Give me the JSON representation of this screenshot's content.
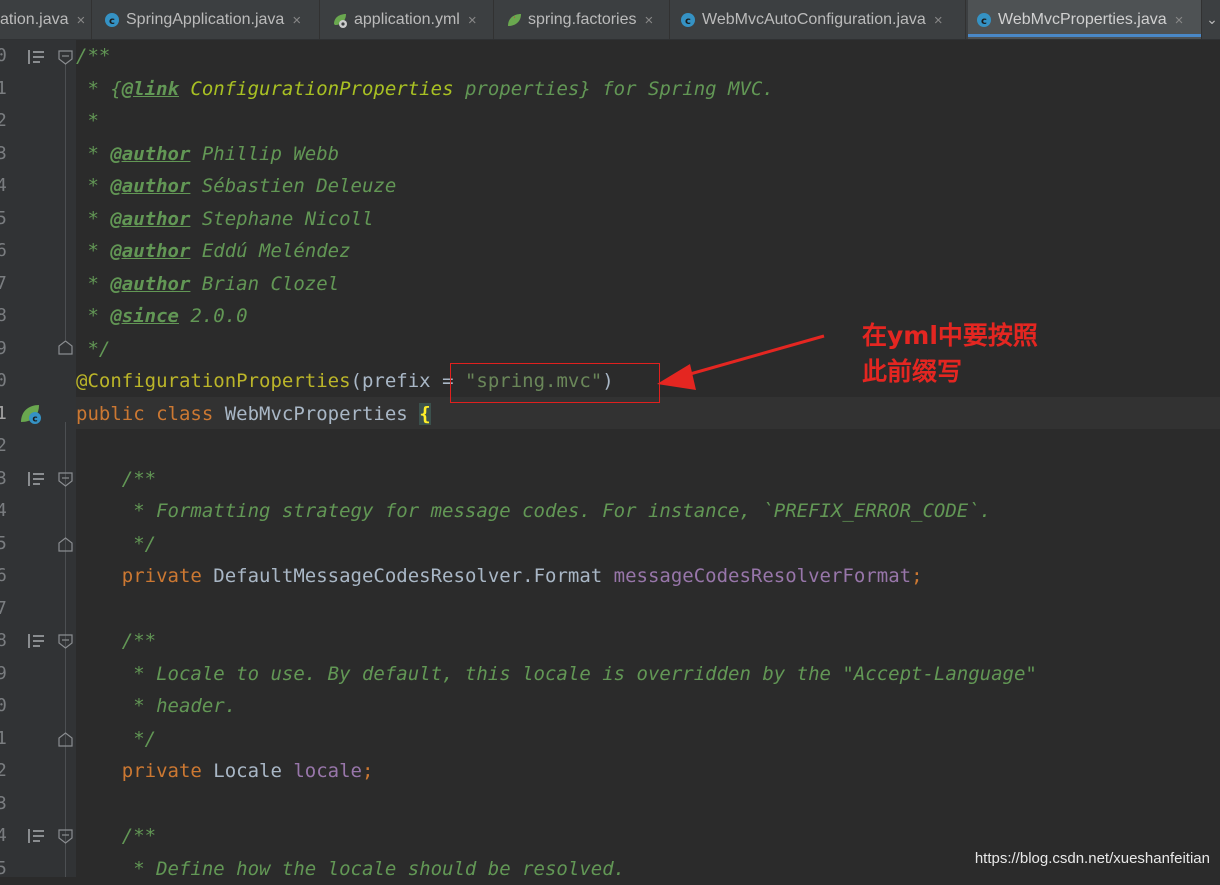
{
  "tabs": [
    {
      "label": "ation.java",
      "icon": "java-class-icon",
      "active": false
    },
    {
      "label": "SpringApplication.java",
      "icon": "java-class-icon",
      "active": false
    },
    {
      "label": "application.yml",
      "icon": "spring-yml-icon",
      "active": false
    },
    {
      "label": "spring.factories",
      "icon": "spring-leaf-icon",
      "active": false
    },
    {
      "label": "WebMvcAutoConfiguration.java",
      "icon": "java-class-icon",
      "active": false
    },
    {
      "label": "WebMvcProperties.java",
      "icon": "java-class-icon",
      "active": true
    }
  ],
  "tab_close_glyph": "×",
  "tab_more_glyph": "⌄",
  "line_numbers": [
    "0",
    "1",
    "2",
    "3",
    "4",
    "5",
    "6",
    "7",
    "8",
    "9",
    "0",
    "1",
    "2",
    "3",
    "4",
    "5",
    "6",
    "7",
    "8",
    "9",
    "0",
    "1",
    "2",
    "3",
    "4",
    "5"
  ],
  "current_line_number": "1",
  "code": {
    "l0": "/**",
    "l1_a": " * {",
    "l1_b": "@link",
    "l1_c": " ConfigurationProperties",
    "l1_d": " properties} for Spring MVC.",
    "l2": " *",
    "l3_a": " * ",
    "l3_b": "@author",
    "l3_c": " Phillip Webb",
    "l4_a": " * ",
    "l4_b": "@author",
    "l4_c": " Sébastien Deleuze",
    "l5_a": " * ",
    "l5_b": "@author",
    "l5_c": " Stephane Nicoll",
    "l6_a": " * ",
    "l6_b": "@author",
    "l6_c": " Eddú Meléndez",
    "l7_a": " * ",
    "l7_b": "@author",
    "l7_c": " Brian Clozel",
    "l8_a": " * ",
    "l8_b": "@since",
    "l8_c": " 2.0.0",
    "l9": " */",
    "l10_a": "@ConfigurationProperties",
    "l10_b": "(prefix ",
    "l10_c": "= ",
    "l10_d": "\"spring.mvc\"",
    "l10_e": ")",
    "l11_a": "public class ",
    "l11_b": "WebMvcProperties ",
    "l11_c": "{",
    "l13": "    /**",
    "l14": "     * Formatting strategy for message codes. For instance, `PREFIX_ERROR_CODE`.",
    "l15": "     */",
    "l16_a": "    private ",
    "l16_b": "DefaultMessageCodesResolver.Format ",
    "l16_c": "messageCodesResolverFormat",
    "l16_d": ";",
    "l18": "    /**",
    "l19": "     * Locale to use. By default, this locale is overridden by the \"Accept-Language\"",
    "l20": "     * header.",
    "l21": "     */",
    "l22_a": "    private ",
    "l22_b": "Locale ",
    "l22_c": "locale",
    "l22_d": ";",
    "l24": "    /**",
    "l25": "     * Define how the locale should be resolved."
  },
  "annotation": {
    "note_line1": "在yml中要按照",
    "note_line2": "此前缀写",
    "color": "#e42621"
  },
  "watermark": "https://blog.csdn.net/xueshanfeitian",
  "colors": {
    "background": "#2b2b2b",
    "gutter": "#313335",
    "doc_comment": "#629755",
    "keyword": "#cc7832",
    "annotation": "#bbb529",
    "string": "#6a8759",
    "field": "#9876aa",
    "tab_active_underline": "#4a88c7"
  }
}
